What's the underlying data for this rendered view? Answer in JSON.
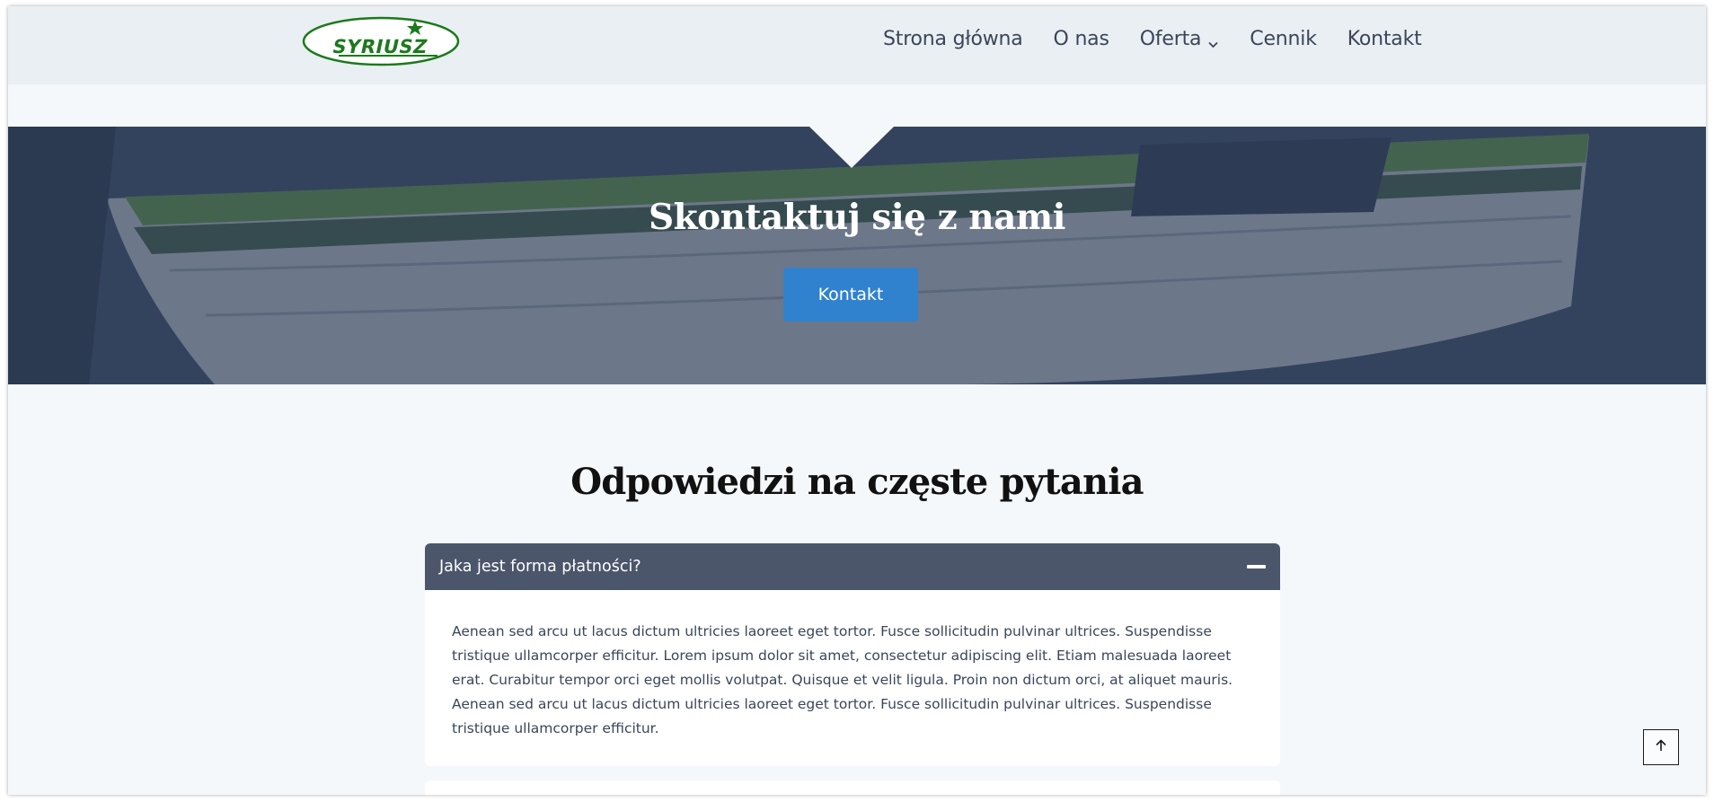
{
  "header": {
    "logo_text": "SYRIUSZ",
    "nav": [
      {
        "label": "Strona główna"
      },
      {
        "label": "O nas"
      },
      {
        "label": "Oferta",
        "has_dropdown": true
      },
      {
        "label": "Cennik"
      },
      {
        "label": "Kontakt"
      }
    ]
  },
  "hero": {
    "title": "Skontaktuj się z nami",
    "button_label": "Kontakt"
  },
  "faq": {
    "title": "Odpowiedzi na częste pytania",
    "items": [
      {
        "question": "Jaka jest forma płatności?",
        "expanded": true,
        "answer": "Aenean sed arcu ut lacus dictum ultricies laoreet eget tortor. Fusce sollicitudin pulvinar ultrices. Suspendisse tristique ullamcorper efficitur. Lorem ipsum dolor sit amet, consectetur adipiscing elit. Etiam malesuada laoreet erat. Curabitur tempor orci eget mollis volutpat. Quisque et velit ligula. Proin non dictum orci, at aliquet mauris. Aenean sed arcu ut lacus dictum ultricies laoreet eget tortor. Fusce sollicitudin pulvinar ultrices. Suspendisse tristique ullamcorper efficitur."
      }
    ]
  },
  "colors": {
    "accent": "#3182ce",
    "accordion_header": "#4b566b",
    "logo_green": "#1b7a1b"
  },
  "icons": {
    "dropdown": "chevron-down-icon",
    "collapse": "minus-icon",
    "scroll_top": "arrow-up-icon"
  }
}
